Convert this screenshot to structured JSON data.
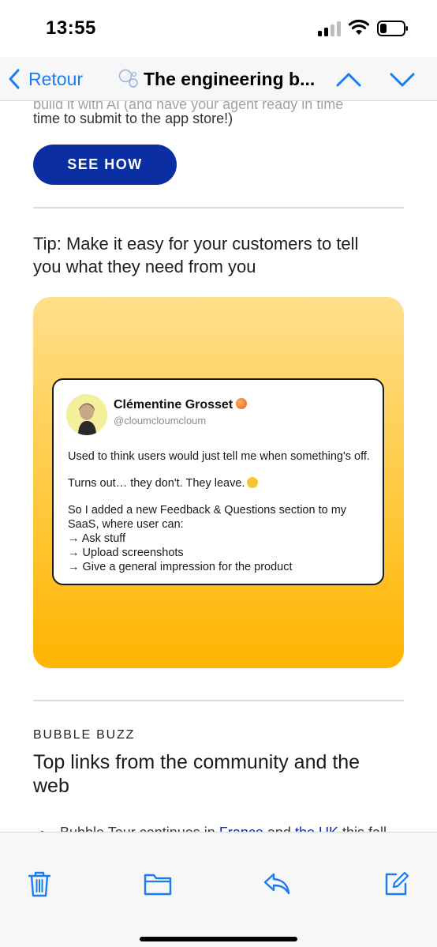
{
  "status": {
    "time": "13:55"
  },
  "nav": {
    "back_label": "Retour",
    "title": "The engineering b..."
  },
  "email": {
    "cut_text": "build it with AI (and have your agent ready in time",
    "para_tail": "time to submit to the app store!)",
    "cta_label": "SEE HOW",
    "tip_heading": "Tip: Make it easy for your customers to tell you what they need from you",
    "tweet": {
      "name": "Clémentine Grosset",
      "handle": "@cloumcloumcloum",
      "lines": [
        "Used to think users would just tell me when something's off.",
        "Turns out… they don't. They leave.",
        "So I added a new Feedback & Questions section to my SaaS, where user can:",
        "→ Ask stuff",
        "→ Upload screenshots",
        "→ Give a general impression for the product"
      ]
    },
    "section_label": "BUBBLE BUZZ",
    "section_title": "Top links from the community and the web",
    "bullet": {
      "prefix": "Bubble Tour continues in",
      "link1": "France",
      "middle": "and",
      "link2": "the UK",
      "suffix": "this fall. See you there?"
    }
  },
  "toolbar": {
    "icons": [
      "trash-icon",
      "folder-icon",
      "reply-icon",
      "compose-icon"
    ]
  },
  "colors": {
    "accent": "#1a7cf3",
    "cta": "#0b2fa3",
    "card_top": "#ffdf8c",
    "card_bottom": "#ffb300"
  }
}
